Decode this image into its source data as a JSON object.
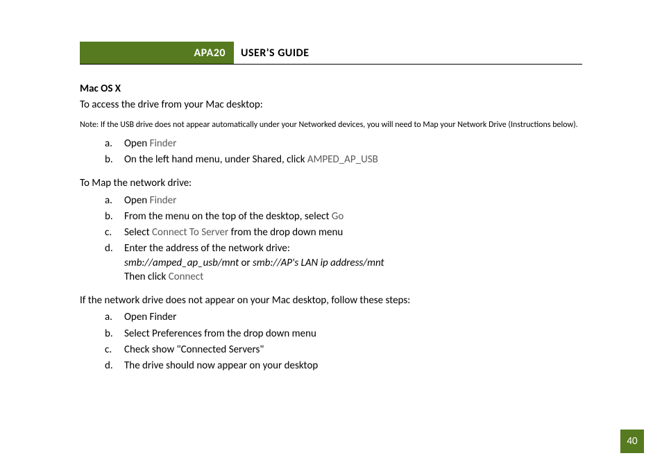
{
  "header": {
    "product": "APA20",
    "title": "USER'S GUIDE"
  },
  "section1": {
    "title": "Mac OS X",
    "intro": "To access the drive from your Mac desktop:",
    "note": "Note: If the USB drive does not appear automatically under your Networked devices, you will need to Map your Network Drive (Instructions below).",
    "items": {
      "a_pre": "Open ",
      "a_gray": "Finder",
      "b_pre": "On the left hand menu, under Shared, click ",
      "b_gray": "AMPED_AP_USB"
    }
  },
  "section2": {
    "intro": "To Map the network drive:",
    "items": {
      "a_pre": "Open ",
      "a_gray": "Finder",
      "b_pre": "From the menu on the top of the desktop, select ",
      "b_gray": "Go",
      "c_pre": "Select ",
      "c_gray": "Connect To Server",
      "c_post": " from the drop down menu",
      "d_line1": "Enter the address of the network drive:",
      "d_addr1": "smb://amped_ap_usb/mnt",
      "d_or": "  or  ",
      "d_addr2": "smb://AP's LAN ip address/mnt",
      "d_then_pre": "Then click ",
      "d_then_gray": "Connect"
    }
  },
  "section3": {
    "intro": "If the network drive does not appear on your Mac desktop, follow these steps:",
    "items": {
      "a": "Open Finder",
      "b": "Select Preferences from the drop down menu",
      "c": "Check show \"Connected Servers\"",
      "d": "The drive should now appear on your desktop"
    }
  },
  "page_number": "40"
}
